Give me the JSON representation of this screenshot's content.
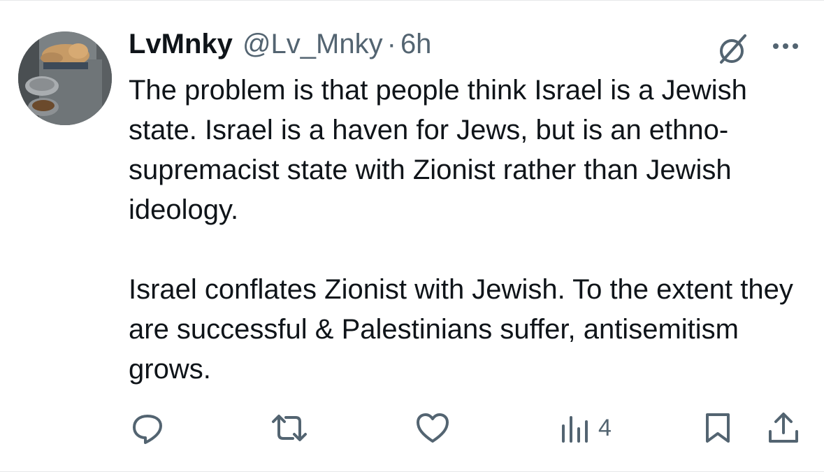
{
  "tweet": {
    "display_name": "LvMnky",
    "handle": "@Lv_Mnky",
    "separator": "·",
    "timestamp": "6h",
    "text": "The problem is that people think Israel is a Jewish state.  Israel is a haven for Jews, but is an ethno-supremacist state with Zionist rather than Jewish ideology.\n\nIsrael conflates Zionist with Jewish. To the extent they are successful & Palestinians suffer, antisemitism grows."
  },
  "actions": {
    "views_count": "4"
  },
  "icons": {
    "avatar": "avatar-cat-photo",
    "grok": "grok-icon",
    "more": "more-icon",
    "reply": "reply-icon",
    "retweet": "retweet-icon",
    "like": "like-icon",
    "views": "views-icon",
    "bookmark": "bookmark-icon",
    "share": "share-icon"
  },
  "colors": {
    "text": "#0f1419",
    "secondary": "#536471",
    "divider": "#e6e8ea"
  }
}
